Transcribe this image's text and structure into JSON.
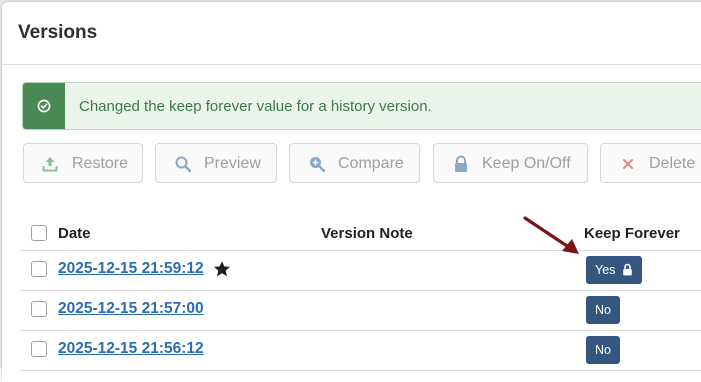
{
  "dialog": {
    "title": "Versions"
  },
  "alert": {
    "message": "Changed the keep forever value for a history version.",
    "icon": "check-circle-icon"
  },
  "toolbar": {
    "restore_label": "Restore",
    "preview_label": "Preview",
    "compare_label": "Compare",
    "keep_label": "Keep On/Off",
    "delete_label": "Delete"
  },
  "table": {
    "columns": {
      "date": "Date",
      "note": "Version Note",
      "keep": "Keep Forever"
    },
    "rows": [
      {
        "date": "2025-12-15 21:59:12",
        "note": "",
        "keep": "Yes",
        "starred": true,
        "locked": true
      },
      {
        "date": "2025-12-15 21:57:00",
        "note": "",
        "keep": "No",
        "starred": false,
        "locked": false
      },
      {
        "date": "2025-12-15 21:56:12",
        "note": "",
        "keep": "No",
        "starred": false,
        "locked": false
      }
    ]
  },
  "colors": {
    "accent": "#35577f",
    "link": "#2b6cb3",
    "success": "#4a8a55",
    "arrow": "#7d1414"
  }
}
